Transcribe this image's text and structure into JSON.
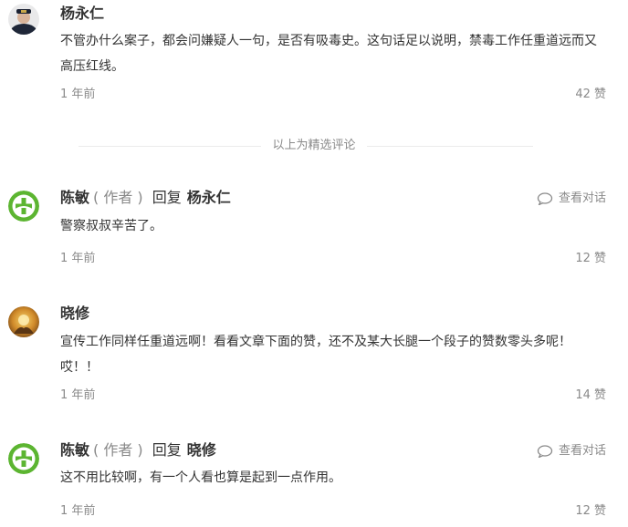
{
  "comments": [
    {
      "name": "杨永仁",
      "text": "不管办什么案子，都会问嫌疑人一句，是否有吸毒史。这句话足以说明，禁毒工作任重道远而又高压红线。",
      "time": "1 年前",
      "likes": "42 赞"
    },
    {
      "name": "陈敏",
      "author_tag": "( 作者 )",
      "reply_word": "回复",
      "reply_to": "杨永仁",
      "view_conversation": "查看对话",
      "text": "警察叔叔辛苦了。",
      "time": "1 年前",
      "likes": "12 赞"
    },
    {
      "name": "晓修",
      "text": "宣传工作同样任重道远啊！看看文章下面的赞，还不及某大长腿一个段子的赞数零头多呢！哎！！",
      "time": "1 年前",
      "likes": "14 赞"
    },
    {
      "name": "陈敏",
      "author_tag": "( 作者 )",
      "reply_word": "回复",
      "reply_to": "晓修",
      "view_conversation": "查看对话",
      "text": "这不用比较啊，有一个人看也算是起到一点作用。",
      "time": "1 年前",
      "likes": "12 赞"
    }
  ],
  "divider_label": "以上为精选评论",
  "icons": {
    "author_avatar": "green-cross-logo-icon",
    "conversation": "speech-bubble-icon"
  },
  "colors": {
    "author_green": "#5cb531",
    "muted": "#8a8a8a"
  }
}
